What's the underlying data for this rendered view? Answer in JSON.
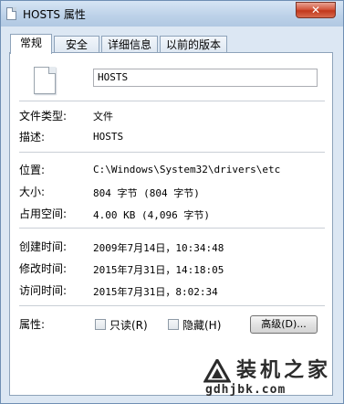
{
  "window": {
    "title": "HOSTS 属性",
    "close_label": "✕"
  },
  "tabs": [
    {
      "label": "常规",
      "active": true
    },
    {
      "label": "安全",
      "active": false
    },
    {
      "label": "详细信息",
      "active": false
    },
    {
      "label": "以前的版本",
      "active": false
    }
  ],
  "general": {
    "file_name": "HOSTS",
    "file_type_label": "文件类型:",
    "file_type_value": "文件",
    "description_label": "描述:",
    "description_value": "HOSTS",
    "location_label": "位置:",
    "location_value": "C:\\Windows\\System32\\drivers\\etc",
    "size_label": "大小:",
    "size_value": "804 字节 (804 字节)",
    "disk_size_label": "占用空间:",
    "disk_size_value": "4.00 KB (4,096 字节)",
    "created_label": "创建时间:",
    "created_value": "2009年7月14日，10:34:48",
    "modified_label": "修改时间:",
    "modified_value": "2015年7月31日，14:18:05",
    "accessed_label": "访问时间:",
    "accessed_value": "2015年7月31日，8:02:34",
    "attributes_label": "属性:",
    "readonly_label": "只读(R)",
    "readonly_checked": false,
    "hidden_label": "隐藏(H)",
    "hidden_checked": false,
    "advanced_button": "高级(D)..."
  },
  "watermark": {
    "text": "装机之家",
    "url": "gdhjbk.com"
  }
}
